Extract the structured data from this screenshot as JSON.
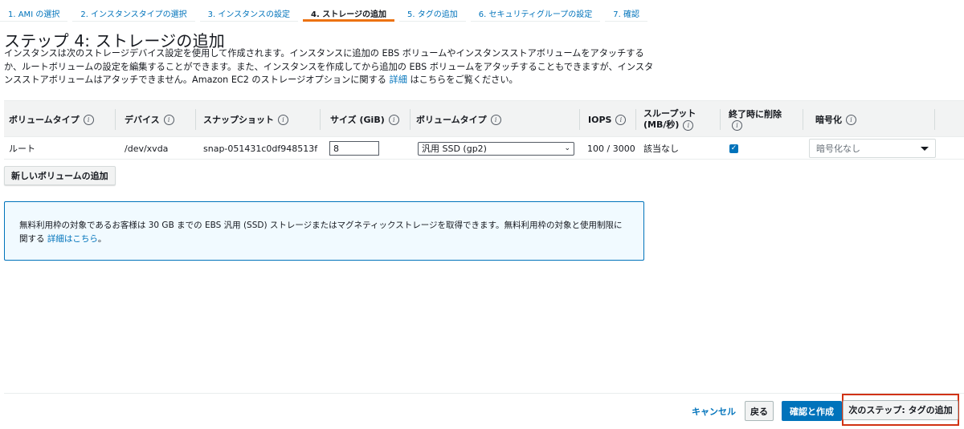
{
  "steps": [
    {
      "label": "1. AMI の選択"
    },
    {
      "label": "2. インスタンスタイプの選択"
    },
    {
      "label": "3. インスタンスの設定"
    },
    {
      "label": "4. ストレージの追加"
    },
    {
      "label": "5. タグの追加"
    },
    {
      "label": "6. セキュリティグループの設定"
    },
    {
      "label": "7. 確認"
    }
  ],
  "page": {
    "title": "ステップ 4: ストレージの追加",
    "description_part1": "インスタンスは次のストレージデバイス設定を使用して作成されます。インスタンスに追加の EBS ボリュームやインスタンスストアボリュームをアタッチするか、ルートボリュームの設定を編集することができます。また、インスタンスを作成してから追加の EBS ボリュームをアタッチすることもできますが、インスタンスストアボリュームはアタッチできません。Amazon EC2 のストレージオプションに関する",
    "description_link": "詳細",
    "description_part2": "はこちらをご覧ください。"
  },
  "table": {
    "headers": {
      "volume_type": "ボリュームタイプ",
      "device": "デバイス",
      "snapshot": "スナップショット",
      "size": "サイズ (GiB)",
      "volume_kind": "ボリュームタイプ",
      "iops": "IOPS",
      "throughput_line1": "スループット",
      "throughput_line2": "(MB/秒)",
      "delete_on_termination": "終了時に削除",
      "encryption": "暗号化"
    },
    "info_glyph": "i",
    "rows": [
      {
        "volume_type": "ルート",
        "device": "/dev/xvda",
        "snapshot": "snap-051431c0df948513f",
        "size": "8",
        "volume_kind": "汎用 SSD (gp2)",
        "iops": "100 / 3000",
        "throughput": "該当なし",
        "delete_on_termination": true,
        "encryption": "暗号化なし"
      }
    ]
  },
  "add_volume_button": "新しいボリュームの追加",
  "info_box": {
    "text": "無料利用枠の対象であるお客様は 30 GB までの EBS 汎用 (SSD) ストレージまたはマグネティックストレージを取得できます。無料利用枠の対象と使用制限に関する",
    "link": "詳細はこちら",
    "suffix": "。"
  },
  "footer": {
    "cancel": "キャンセル",
    "back": "戻る",
    "review_launch": "確認と作成",
    "next": "次のステップ: タグの追加"
  },
  "colors": {
    "accent": "#0073bb",
    "active_tab": "#ec7211",
    "highlight_border": "#d13212"
  }
}
